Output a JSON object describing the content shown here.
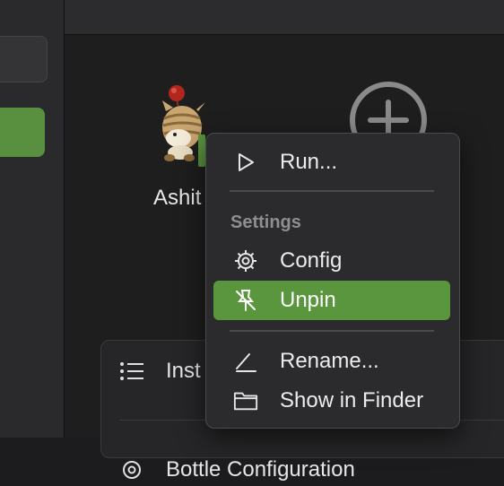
{
  "bottle": {
    "name": "Ashit"
  },
  "info_panel": {
    "row1_label": "Inst",
    "row2_label": "Bottle Configuration"
  },
  "context_menu": {
    "run_label": "Run...",
    "section_settings": "Settings",
    "config_label": "Config",
    "unpin_label": "Unpin",
    "rename_label": "Rename...",
    "show_in_finder_label": "Show in Finder"
  },
  "colors": {
    "accent": "#5a963e",
    "background": "#1e1e1f",
    "menu_background": "#2b2b2d"
  },
  "icons": {
    "run": "play-icon",
    "config": "gear-icon",
    "unpin": "pin-slash-icon",
    "rename": "pencil-icon",
    "show_in_finder": "folder-icon",
    "add_bottle": "plus-circle-icon",
    "installed": "list-icon"
  }
}
